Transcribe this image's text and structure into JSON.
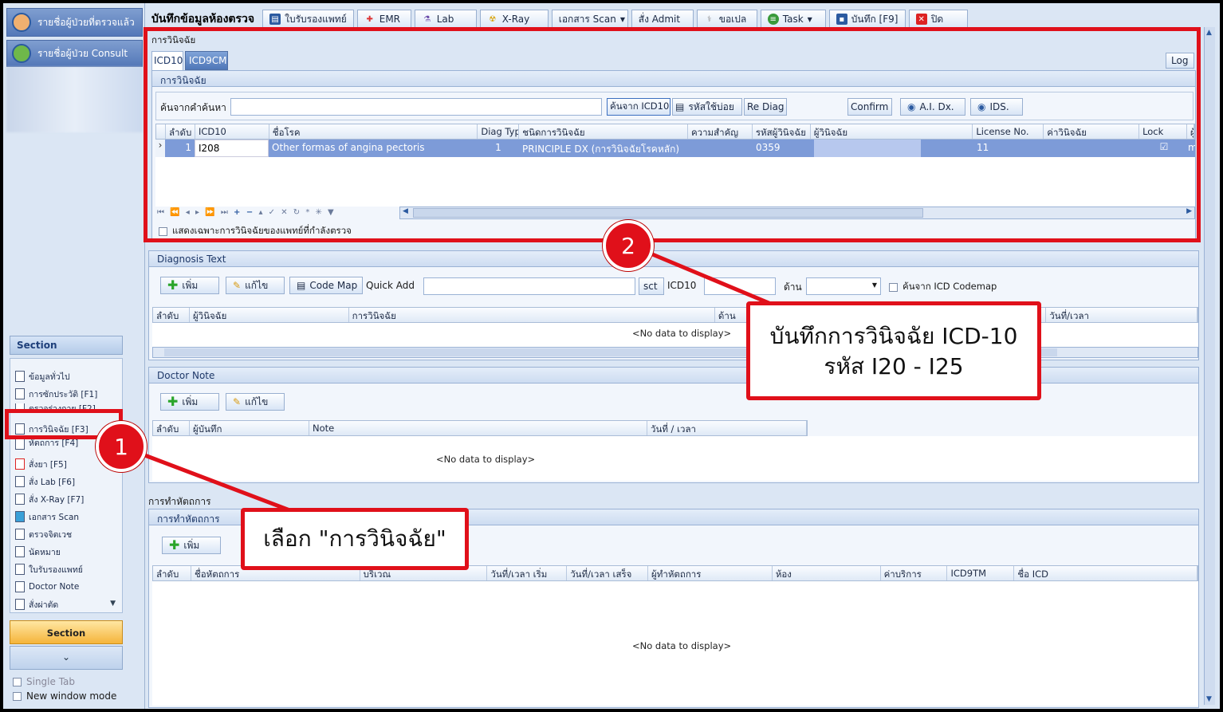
{
  "sidebar": {
    "nav1": "รายชื่อผู้ป่วยที่ตรวจแล้ว",
    "nav2": "รายชื่อผู้ป่วย Consult",
    "section_header": "Section",
    "items": [
      "ข้อมูลทั่วไป",
      "การซักประวัติ [F1]",
      "ตรวจร่างกาย [F2]",
      "การวินิจฉัย [F3]",
      "หัตถการ [F4]",
      "สั่งยา [F5]",
      "สั่ง Lab  [F6]",
      "สั่ง X-Ray  [F7]",
      "เอกสาร Scan",
      "ตรวจจิตเวช",
      "นัดหมาย",
      "ใบรับรองแพทย์",
      "Doctor Note",
      "สั่งผ่าตัด"
    ],
    "section_button": "Section",
    "single_tab": "Single Tab",
    "new_window": "New window mode"
  },
  "toolbar": {
    "title": "บันทึกข้อมูลห้องตรวจ",
    "buttons": [
      "ใบรับรองแพทย์",
      "EMR",
      "Lab",
      "X-Ray",
      "เอกสาร Scan",
      "สั่ง Admit",
      "ขอเปล",
      "Task",
      "บันทึก [F9]",
      "ปิด"
    ]
  },
  "diagnosis": {
    "outer_label": "การวินิจฉัย",
    "tab_icd10": "ICD10",
    "tab_icd9cm": "ICD9CM",
    "log_button": "Log",
    "inner_label": "การวินิจฉัย",
    "search_label": "ค้นจากคำค้นหา",
    "btn_search_icd10": "ค้นจาก ICD10",
    "btn_frequent": "รหัสใช้บ่อย",
    "btn_rediag": "Re Diag",
    "btn_confirm": "Confirm",
    "btn_ai": "A.I. Dx.",
    "btn_ids": "IDS.",
    "columns": [
      "ลำดับ",
      "ICD10",
      "ชื่อโรค",
      "Diag Type",
      "ชนิดการวินิจฉัย",
      "ความสำคัญ",
      "รหัสผู้วินิจฉัย",
      "ผู้วินิจฉัย",
      "License No.",
      "ค่าวินิจฉัย",
      "Lock",
      "ผู้"
    ],
    "row": {
      "seq": "1",
      "icd10": "I208",
      "disease": "Other formas of angina pectoris",
      "diag_type": "1",
      "kind": "PRINCIPLE DX (การวินิจฉัยโรคหลัก)",
      "priority": "",
      "doctor_code": "0359",
      "doctor": "",
      "license": "11",
      "value": "",
      "lock": "☑",
      "extra": "m"
    },
    "only_mine": "แสดงเฉพาะการวินิจฉัยของแพทย์ที่กำลังตรวจ"
  },
  "diagnosis_text": {
    "header": "Diagnosis Text",
    "btn_add": "เพิ่ม",
    "btn_edit": "แก้ไข",
    "btn_codemap": "Code Map",
    "quick_add": "Quick Add",
    "btn_sct": "sct",
    "icd10_label": "ICD10",
    "side_label": "ด้าน",
    "codemap_check": "ค้นจาก ICD Codemap",
    "columns": [
      "ลำดับ",
      "ผู้วินิจฉัย",
      "การวินิจฉัย",
      "ด้าน",
      "วันที่/เวลา"
    ],
    "nodata": "<No data to display>"
  },
  "doctor_note": {
    "header": "Doctor Note",
    "btn_add": "เพิ่ม",
    "btn_edit": "แก้ไข",
    "columns": [
      "ลำดับ",
      "ผู้บันทึก",
      "Note",
      "วันที่ / เวลา"
    ],
    "nodata": "<No data to display>"
  },
  "procedure": {
    "outer_label": "การทำหัตถการ",
    "header": "การทำหัตถการ",
    "btn_add": "เพิ่ม",
    "columns": [
      "ลำดับ",
      "ชื่อหัตถการ",
      "บริเวณ",
      "วันที่/เวลา เริ่ม",
      "วันที่/เวลา เสร็จ",
      "ผู้ทำหัตถการ",
      "ห้อง",
      "ค่าบริการ",
      "ICD9TM",
      "ชื่อ ICD"
    ],
    "nodata": "<No data to display>"
  },
  "annotations": {
    "step1": "1",
    "step2": "2",
    "callout1": "เลือก \"การวินิจฉัย\"",
    "callout2_line1": "บันทึกการวินิจฉัย ICD-10",
    "callout2_line2": "รหัส I20 - I25",
    "accent": "#e0101a"
  }
}
